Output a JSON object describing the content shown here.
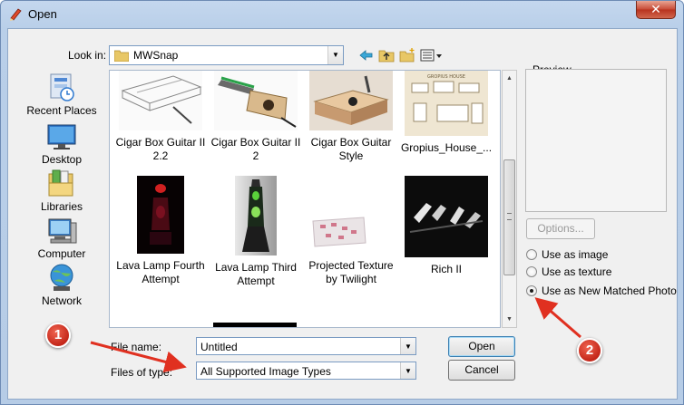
{
  "window": {
    "title": "Open",
    "close_label": "✕"
  },
  "toolbar": {
    "look_in_label": "Look in:",
    "look_in_value": "MWSnap"
  },
  "places": [
    {
      "label": "Recent Places",
      "icon": "recent-places-icon"
    },
    {
      "label": "Desktop",
      "icon": "desktop-icon"
    },
    {
      "label": "Libraries",
      "icon": "libraries-icon"
    },
    {
      "label": "Computer",
      "icon": "computer-icon"
    },
    {
      "label": "Network",
      "icon": "network-icon"
    }
  ],
  "files": [
    {
      "line1": "Cigar Box Guitar II",
      "line2": "2.2"
    },
    {
      "line1": "Cigar Box Guitar II",
      "line2": "2"
    },
    {
      "line1": "Cigar Box Guitar",
      "line2": "Style"
    },
    {
      "line1": "Gropius_House_...",
      "line2": ""
    },
    {
      "line1": "Lava Lamp Fourth",
      "line2": "Attempt"
    },
    {
      "line1": "Lava Lamp Third",
      "line2": "Attempt"
    },
    {
      "line1": "Projected Texture",
      "line2": "by Twilight"
    },
    {
      "line1": "Rich II",
      "line2": ""
    }
  ],
  "preview": {
    "label": "Preview",
    "options_label": "Options...",
    "radios": [
      {
        "label": "Use as image",
        "checked": false
      },
      {
        "label": "Use as texture",
        "checked": false
      },
      {
        "label": "Use as New Matched Photo",
        "checked": true
      }
    ]
  },
  "bottom": {
    "file_name_label": "File name:",
    "file_name_value": "Untitled",
    "file_type_label": "Files of type:",
    "file_type_value": "All Supported Image Types",
    "open_label": "Open",
    "cancel_label": "Cancel"
  },
  "annotations": {
    "badge1": "1",
    "badge2": "2",
    "color": "#e03020"
  },
  "colors": {
    "title_bar": "#c4d7ee",
    "close_button": "#c74a35",
    "dialog_bg": "#f0f0f0"
  }
}
